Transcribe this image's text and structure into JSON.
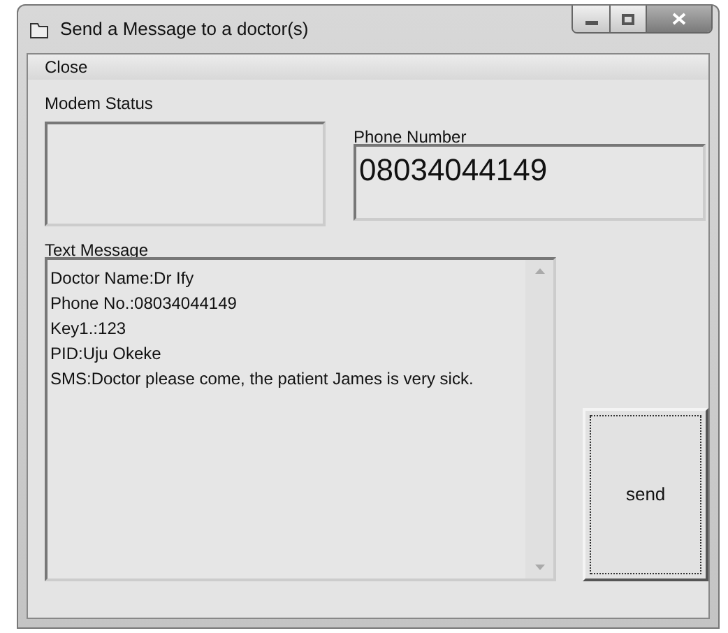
{
  "window": {
    "title": "Send a Message to a doctor(s)"
  },
  "menu": [
    "Close"
  ],
  "modem_status": {
    "label": "Modem Status"
  },
  "phone_number": {
    "label": "Phone Number",
    "value": "08034044149"
  },
  "text_message": {
    "label": "Text Message",
    "lines": [
      "Doctor Name:Dr Ify",
      "Phone No.:08034044149",
      "Key1.:123",
      "PID:Uju Okeke",
      "SMS:Doctor please come, the patient James is very sick."
    ]
  },
  "buttons": [
    {
      "label": "send",
      "focused": true
    }
  ]
}
